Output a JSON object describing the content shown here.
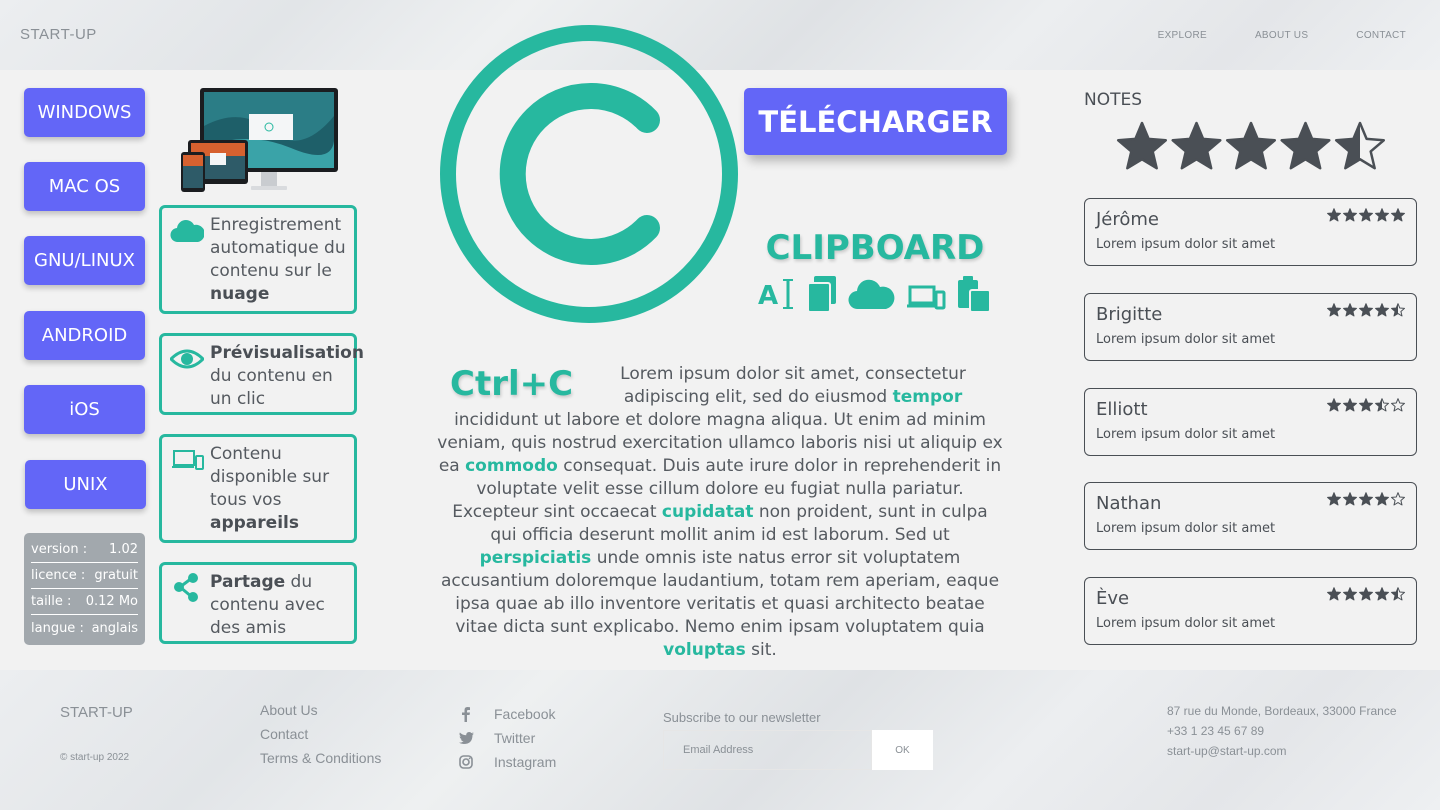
{
  "header": {
    "brand": "START-UP",
    "nav": [
      "EXPLORE",
      "ABOUT US",
      "CONTACT"
    ]
  },
  "platforms": [
    "WINDOWS",
    "MAC OS",
    "GNU/LINUX",
    "ANDROID",
    "iOS",
    "UNIX"
  ],
  "info": [
    {
      "label": "version :",
      "value": "1.02"
    },
    {
      "label": "licence :",
      "value": "gratuit"
    },
    {
      "label": "taille :",
      "value": "0.12 Mo"
    },
    {
      "label": "langue :",
      "value": "anglais"
    }
  ],
  "features": [
    {
      "text": "Enregistrement automatique du contenu sur le ",
      "bold": "nuage",
      "icon": "cloud-icon"
    },
    {
      "bold": "Prévisualisation",
      "text": " du contenu en un clic",
      "icon": "eye-icon"
    },
    {
      "text": "Contenu disponible sur tous vos ",
      "bold": "appareils",
      "icon": "devices-icon"
    },
    {
      "bold": "Partage",
      "text": " du contenu avec des amis",
      "icon": "share-icon"
    }
  ],
  "download_label": "TÉLÉCHARGER",
  "clipboard_title": "CLIPBOARD",
  "clipboard_icons": [
    "text-cursor-icon",
    "copy-icon",
    "cloud-icon",
    "devices-icon",
    "paste-icon"
  ],
  "ctrlc": "Ctrl+C",
  "body_parts": [
    "Lorem ipsum dolor sit amet, consectetur adipiscing elit, sed do eiusmod ",
    "tempor",
    " incididunt ut labore et dolore magna aliqua. Ut enim ad minim veniam, quis nostrud exercitation ullamco laboris nisi ut aliquip ex ea ",
    "commodo",
    " consequat. Duis aute irure dolor in reprehenderit in voluptate velit esse cillum dolore eu fugiat nulla pariatur. Excepteur sint occaecat ",
    "cupidatat",
    " non proident, sunt in culpa qui officia deserunt mollit anim id est laborum. Sed ut ",
    "perspiciatis",
    " unde omnis iste natus error sit voluptatem accusantium doloremque laudantium, totam rem aperiam, eaque ipsa quae ab illo inventore veritatis et quasi architecto beatae vitae dicta sunt explicabo. Nemo enim ipsam voluptatem quia ",
    "voluptas",
    " sit."
  ],
  "notes": {
    "title": "NOTES",
    "overall_rating": 4.5,
    "reviews": [
      {
        "name": "Jérôme",
        "text": "Lorem ipsum dolor sit amet",
        "rating": 5
      },
      {
        "name": "Brigitte",
        "text": "Lorem ipsum dolor sit amet",
        "rating": 4.5
      },
      {
        "name": "Elliott",
        "text": "Lorem ipsum dolor sit amet",
        "rating": 3.5
      },
      {
        "name": "Nathan",
        "text": "Lorem ipsum dolor sit amet",
        "rating": 4
      },
      {
        "name": "Ève",
        "text": "Lorem ipsum dolor sit amet",
        "rating": 4.5
      }
    ]
  },
  "footer": {
    "brand": "START-UP",
    "copyright": "© start-up 2022",
    "links": [
      "About Us",
      "Contact",
      "Terms & Conditions"
    ],
    "social": [
      {
        "label": "Facebook",
        "icon": "facebook-icon"
      },
      {
        "label": "Twitter",
        "icon": "twitter-icon"
      },
      {
        "label": "Instagram",
        "icon": "instagram-icon"
      }
    ],
    "newsletter_label": "Subscribe to our newsletter",
    "email_placeholder": "Email Address",
    "ok_label": "OK",
    "address": "87 rue du Monde, Bordeaux, 33000 France",
    "phone": "+33 1 23 45 67 89",
    "email": "start-up@start-up.com"
  },
  "colors": {
    "accent": "#27b89f",
    "button": "#6366f7",
    "text": "#4a4f55",
    "muted": "#8a9096",
    "info_bg": "#a2a8ad"
  }
}
